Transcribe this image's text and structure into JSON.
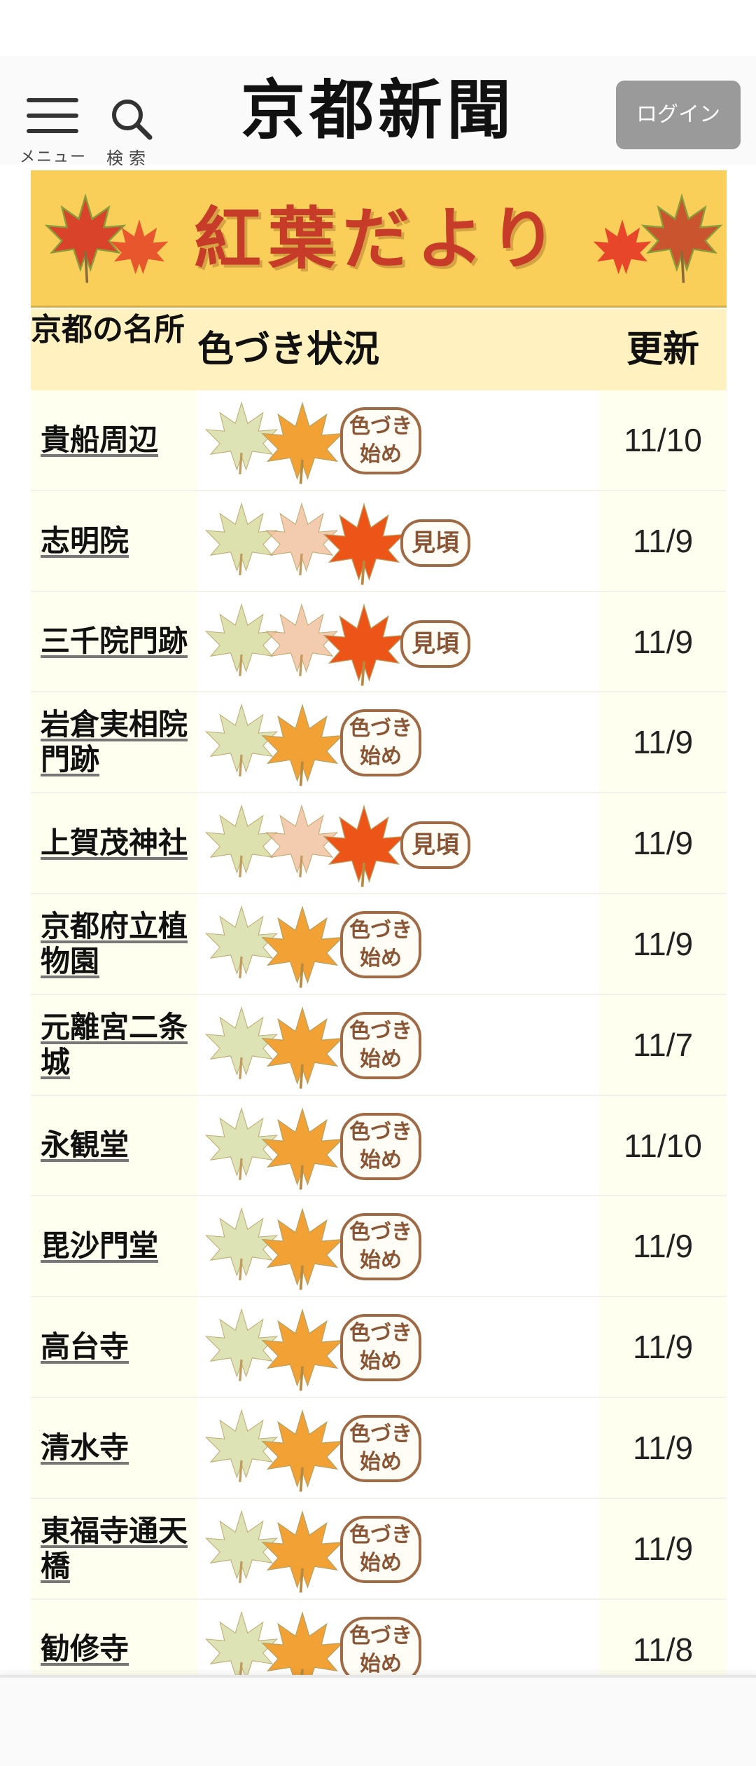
{
  "header": {
    "menu_label": "メニュー",
    "search_label": "検索",
    "logo_text": "京都新聞",
    "login_label": "ログイン"
  },
  "banner": {
    "title": "紅葉だより"
  },
  "table": {
    "headers": {
      "place": "京都の名所",
      "status": "色づき状況",
      "update": "更新"
    },
    "rows": [
      {
        "place": "貴船周辺",
        "status": "色づき始め",
        "date": "11/10"
      },
      {
        "place": "志明院",
        "status": "見頃",
        "date": "11/9"
      },
      {
        "place": "三千院門跡",
        "status": "見頃",
        "date": "11/9"
      },
      {
        "place": "岩倉実相院門跡",
        "status": "色づき始め",
        "date": "11/9"
      },
      {
        "place": "上賀茂神社",
        "status": "見頃",
        "date": "11/9"
      },
      {
        "place": "京都府立植物園",
        "status": "色づき始め",
        "date": "11/9"
      },
      {
        "place": "元離宮二条城",
        "status": "色づき始め",
        "date": "11/7"
      },
      {
        "place": "永観堂",
        "status": "色づき始め",
        "date": "11/10"
      },
      {
        "place": "毘沙門堂",
        "status": "色づき始め",
        "date": "11/9"
      },
      {
        "place": "高台寺",
        "status": "色づき始め",
        "date": "11/9"
      },
      {
        "place": "清水寺",
        "status": "色づき始め",
        "date": "11/9"
      },
      {
        "place": "東福寺通天橋",
        "status": "色づき始め",
        "date": "11/9"
      },
      {
        "place": "勧修寺",
        "status": "色づき始め",
        "date": "11/8"
      }
    ]
  },
  "badges": {
    "start": "色づき始め",
    "peak": "見頃"
  },
  "colors": {
    "banner_bg": "#f9cf5a",
    "banner_text": "#c63c28",
    "header_row_bg": "#fff2c0",
    "login_bg": "#9a9a9a"
  }
}
